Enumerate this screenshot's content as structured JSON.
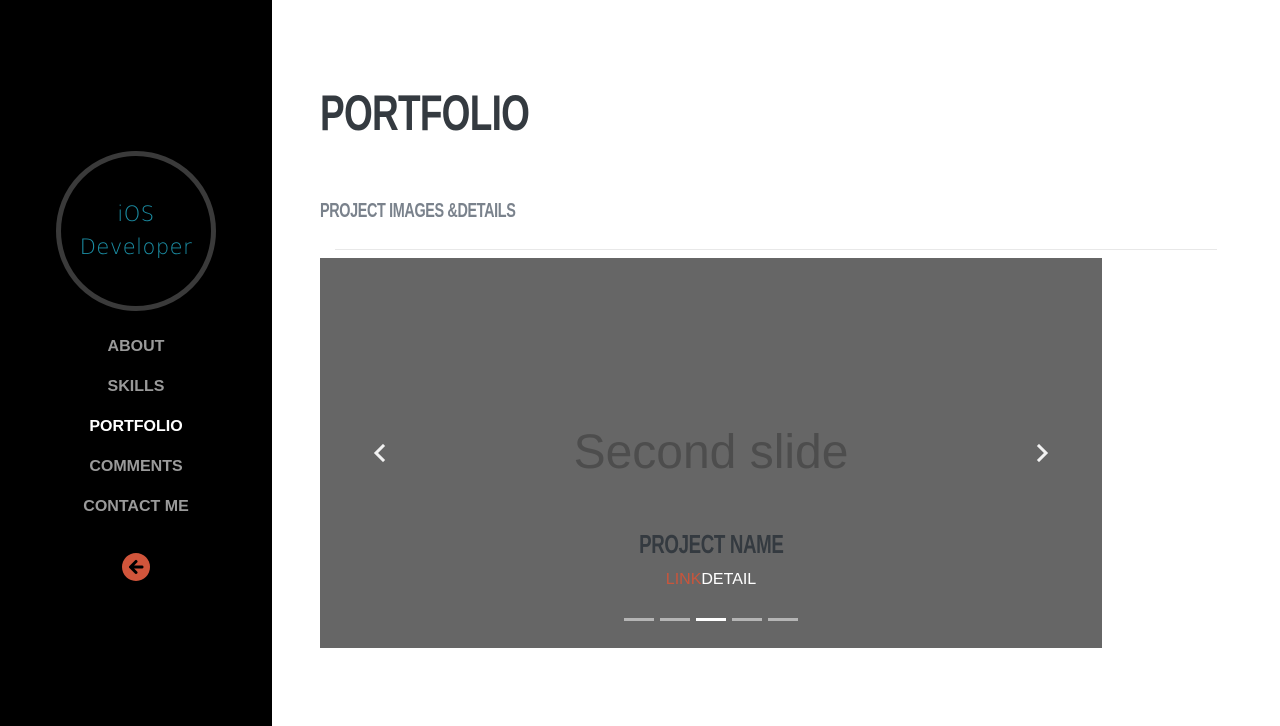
{
  "sidebar": {
    "logo": {
      "line1": "iOS",
      "line2": "Developer"
    },
    "nav": [
      {
        "label": "ABOUT",
        "active": false
      },
      {
        "label": "SKILLS",
        "active": false
      },
      {
        "label": "PORTFOLIO",
        "active": true
      },
      {
        "label": "COMMENTS",
        "active": false
      },
      {
        "label": "CONTACT ME",
        "active": false
      }
    ],
    "back_icon": "arrow-left-circle-icon"
  },
  "main": {
    "title": "PORTFOLIO",
    "subtitle": "PROJECT IMAGES &DETAILS",
    "carousel": {
      "slide_text": "Second slide",
      "caption_title": "PROJECT NAME",
      "link_label": "LINK",
      "detail_label": "DETAIL",
      "indicator_count": 5,
      "active_index": 2,
      "prev_icon": "chevron-left-icon",
      "next_icon": "chevron-right-icon"
    }
  },
  "colors": {
    "sidebar_bg": "#000000",
    "logo_text": "#1b8fa6",
    "accent": "#d1553b",
    "carousel_bg": "#666666",
    "title_text": "#343a40"
  }
}
